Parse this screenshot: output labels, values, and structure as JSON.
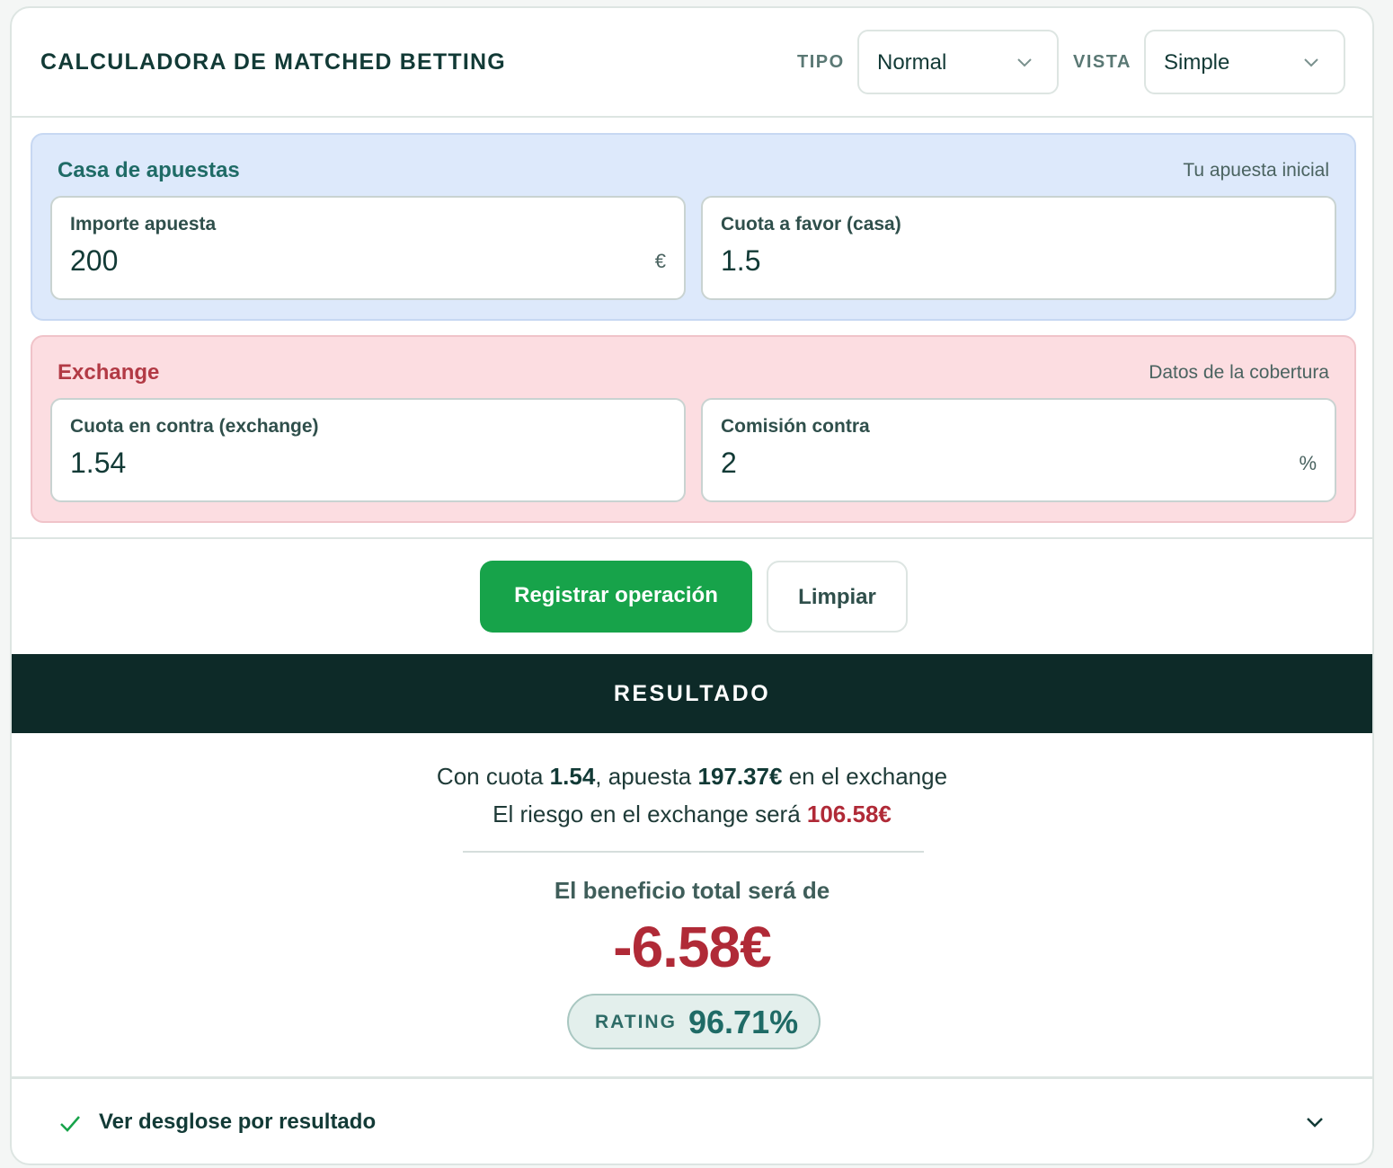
{
  "header": {
    "title": "CALCULADORA DE MATCHED BETTING",
    "tipo_label": "TIPO",
    "tipo_value": "Normal",
    "vista_label": "VISTA",
    "vista_value": "Simple"
  },
  "casa": {
    "title": "Casa de apuestas",
    "subtitle": "Tu apuesta inicial",
    "importe_label": "Importe apuesta",
    "importe_value": "200",
    "importe_unit": "€",
    "cuota_label": "Cuota a favor (casa)",
    "cuota_value": "1.5"
  },
  "exchange": {
    "title": "Exchange",
    "subtitle": "Datos de la cobertura",
    "cuota_label": "Cuota en contra (exchange)",
    "cuota_value": "1.54",
    "comision_label": "Comisión contra",
    "comision_value": "2",
    "comision_unit": "%"
  },
  "buttons": {
    "registrar": "Registrar operación",
    "limpiar": "Limpiar"
  },
  "result": {
    "heading": "RESULTADO",
    "line1_pre": "Con cuota ",
    "line1_cuota": "1.54",
    "line1_mid": ", apuesta ",
    "line1_amount": "197.37€",
    "line1_post": " en el exchange",
    "line2_pre": "El riesgo en el exchange será ",
    "line2_risk": "106.58€",
    "benefit_label": "El beneficio total será de",
    "benefit_value": "-6.58€",
    "rating_label": "RATING",
    "rating_value": "96.71%"
  },
  "footer": {
    "label": "Ver desglose por resultado"
  },
  "colors": {
    "primary_green": "#17a34a",
    "negative_red": "#b02a37",
    "dark_teal": "#0d2a28"
  }
}
